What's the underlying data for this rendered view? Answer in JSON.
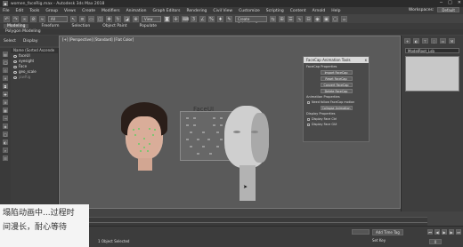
{
  "window": {
    "title": "women_faceRig.max - Autodesk 3ds Max 2018",
    "controls": [
      "─",
      "□",
      "✕"
    ]
  },
  "menu": {
    "items": [
      "File",
      "Edit",
      "Tools",
      "Group",
      "Views",
      "Create",
      "Modifiers",
      "Animation",
      "Graph Editors",
      "Rendering",
      "Civil View",
      "Customize",
      "Scripting",
      "Content",
      "Arnold",
      "Help"
    ],
    "workspace_label": "Workspaces:",
    "workspace_value": "Default"
  },
  "ribbon": {
    "tabs": [
      "Modeling",
      "Freeform",
      "Selection",
      "Object Paint",
      "Populate"
    ],
    "sub": "Polygon Modeling"
  },
  "toolbar": {
    "selection_filter": "All",
    "view_select": "View",
    "named_set": "Create Selection Se"
  },
  "scene_explorer": {
    "tabs": [
      "Select",
      "Display"
    ],
    "header": "Name (Sorted Ascende",
    "rows": [
      "faceUI",
      "eyesight",
      "Face",
      "geo_scale",
      "jawRig"
    ]
  },
  "viewport": {
    "label": "[+] [Perspective] [Standard] [Flat Color]",
    "faceui_label": "FaceUI"
  },
  "dialog": {
    "title": "FaceCap Animation Tools",
    "close": "x",
    "section1": "FaceCap Properties",
    "buttons1": [
      "Import FaceCap",
      "Reset FaceCap",
      "Convert FaceCap",
      "Delete FaceCap"
    ],
    "section2": "Animation Properties",
    "opt_native": "Need follow FaceCap motion",
    "btn_collapse": "Collapse Animation",
    "section3": "Display Properties",
    "opt_ctrl": "Display Face Ctrl",
    "opt_gui": "Display Face GUI"
  },
  "command_panel": {
    "field": "ModelRoot_Lsb"
  },
  "overlay": {
    "line1": "塌陷动画中...过程时",
    "line2": "间漫长，耐心等待"
  },
  "status": {
    "selected": "1 Object Selected",
    "auto": "Auto",
    "add_key": "Add Time Tag",
    "set_key": "Set Key",
    "frame": "0"
  }
}
